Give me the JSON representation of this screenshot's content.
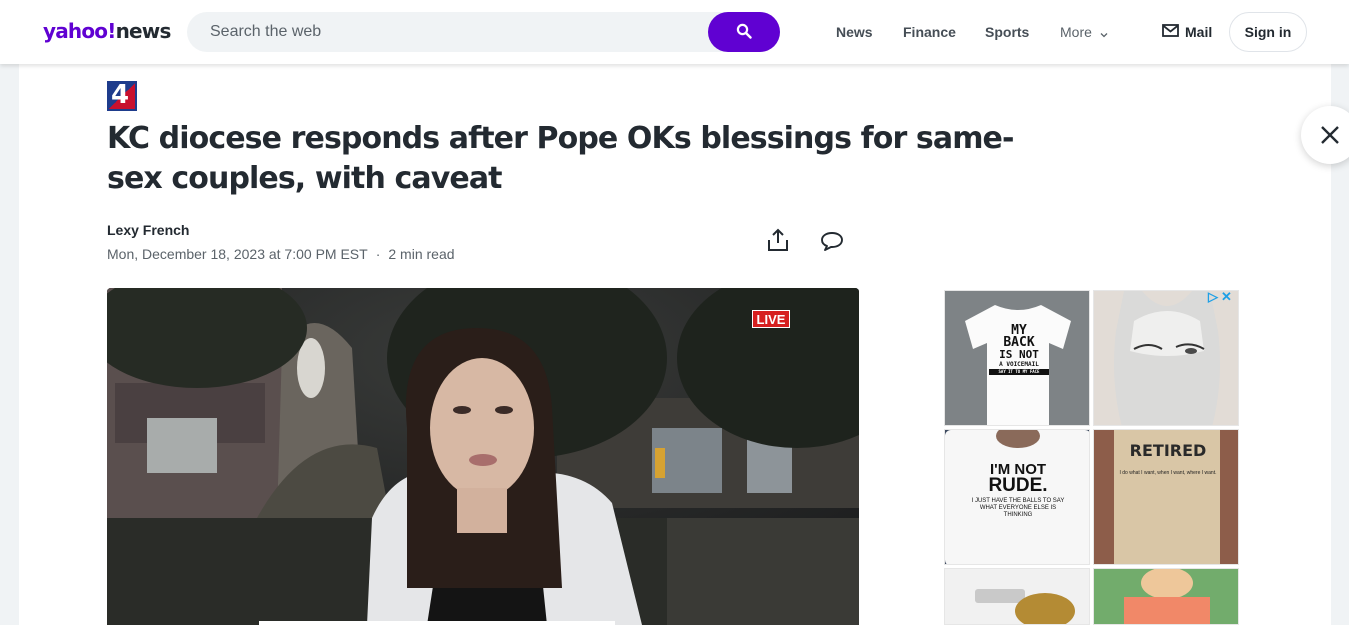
{
  "header": {
    "logo_yahoo": "yahoo!",
    "logo_news": "news",
    "search_placeholder": "Search the web",
    "nav": {
      "news": "News",
      "finance": "Finance",
      "sports": "Sports",
      "more": "More"
    },
    "mail_label": "Mail",
    "signin_label": "Sign in"
  },
  "article": {
    "publisher_logo_text": "4",
    "headline": "KC diocese responds after Pope OKs blessings for same-sex couples, with caveat",
    "author": "Lexy French",
    "date": "Mon, December 18, 2023 at 7:00 PM EST",
    "separator": "·",
    "read_time": "2 min read"
  },
  "video": {
    "live_label": "LIVE"
  },
  "ad": {
    "tiles": [
      {
        "lines": [
          "MY",
          "BACK",
          "IS NOT",
          "A VOICEMAIL"
        ],
        "caption": "SAY IT TO MY FACE"
      },
      {
        "lines": []
      },
      {
        "lines": [
          "I'M NOT",
          "RUDE."
        ],
        "caption": "I JUST HAVE THE BALLS TO SAY WHAT EVERYONE ELSE IS THINKING"
      },
      {
        "lines": [
          "RETIRED"
        ],
        "caption": "I do what I want, when I want, where I want."
      },
      {
        "lines": []
      },
      {
        "lines": []
      }
    ]
  },
  "colors": {
    "brand_purple": "#6001d2",
    "live_red": "#d61f1f",
    "text_primary": "#232a31",
    "text_secondary": "#5b636a"
  },
  "icons": [
    "search-icon",
    "chevron-down-icon",
    "mail-icon",
    "share-icon",
    "comment-icon",
    "close-icon",
    "ad-choices-icon"
  ]
}
